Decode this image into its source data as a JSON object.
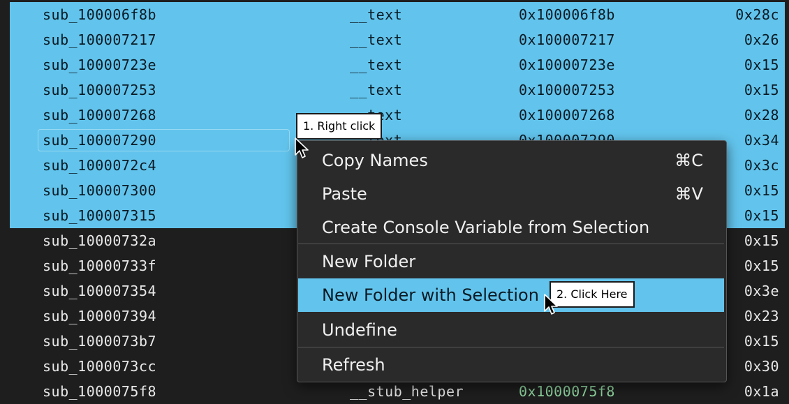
{
  "rows": [
    {
      "name": "sub_100006f8b",
      "section": "__text",
      "address": "0x100006f8b",
      "size": "0x28c"
    },
    {
      "name": "sub_100007217",
      "section": "__text",
      "address": "0x100007217",
      "size": "0x26"
    },
    {
      "name": "sub_10000723e",
      "section": "__text",
      "address": "0x10000723e",
      "size": "0x15"
    },
    {
      "name": "sub_100007253",
      "section": "__text",
      "address": "0x100007253",
      "size": "0x15"
    },
    {
      "name": "sub_100007268",
      "section": "__text",
      "address": "0x100007268",
      "size": "0x28"
    },
    {
      "name": "sub_100007290",
      "section": "__text",
      "address": "0x100007290",
      "size": "0x34"
    },
    {
      "name": "sub_1000072c4",
      "section": "",
      "address": "",
      "size": "0x3c"
    },
    {
      "name": "sub_100007300",
      "section": "",
      "address": "",
      "size": "0x15"
    },
    {
      "name": "sub_100007315",
      "section": "",
      "address": "",
      "size": "0x15"
    },
    {
      "name": "sub_10000732a",
      "section": "",
      "address": "",
      "size": "0x15"
    },
    {
      "name": "sub_10000733f",
      "section": "",
      "address": "",
      "size": "0x15"
    },
    {
      "name": "sub_100007354",
      "section": "",
      "address": "",
      "size": "0x3e"
    },
    {
      "name": "sub_100007394",
      "section": "",
      "address": "",
      "size": "0x23"
    },
    {
      "name": "sub_1000073b7",
      "section": "",
      "address": "",
      "size": "0x15"
    },
    {
      "name": "sub_1000073cc",
      "section": "",
      "address": "",
      "size": "0x30"
    },
    {
      "name": "sub_1000075f8",
      "section": "__stub_helper",
      "address": "0x1000075f8",
      "size": "0x1a"
    }
  ],
  "menu": {
    "copy_names": {
      "label": "Copy Names",
      "shortcut": "⌘C"
    },
    "paste": {
      "label": "Paste",
      "shortcut": "⌘V"
    },
    "create_console_variable": {
      "label": "Create Console Variable from Selection"
    },
    "new_folder": {
      "label": "New Folder"
    },
    "new_folder_with_selection": {
      "label": "New Folder with Selection"
    },
    "undefine": {
      "label": "Undefine"
    },
    "refresh": {
      "label": "Refresh"
    }
  },
  "callouts": {
    "step1": "1. Right click",
    "step2": "2. Click Here"
  },
  "colors": {
    "selection": "#62c4ec",
    "background": "#1e1e1e",
    "menu_background": "#2a2a2a",
    "stub_address": "#8fd6a0"
  },
  "icons": [
    "mouse-pointer-icon"
  ]
}
